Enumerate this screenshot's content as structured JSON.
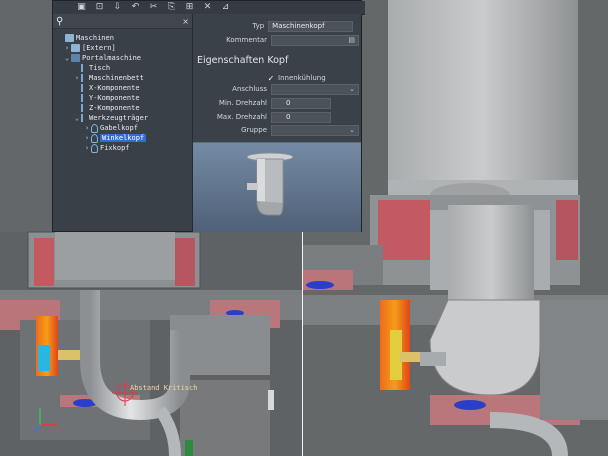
{
  "toolbar": {
    "icons": [
      "search-icon",
      "save-icon",
      "export-icon",
      "import-icon",
      "undo-icon",
      "cut-icon",
      "copy-icon",
      "paste-icon",
      "delete-icon",
      "machine-icon"
    ],
    "glyphs": [
      "",
      "▣",
      "⊡",
      "⇩",
      "↶",
      "✂",
      "⎘",
      "⊞",
      "✕",
      "⊿"
    ]
  },
  "tree": {
    "search_placeholder": "",
    "clear_glyph": "×",
    "nodes": [
      {
        "label": "Maschinen",
        "arrow": "",
        "icon": "folder"
      },
      {
        "label": "[Extern]",
        "arrow": "›",
        "icon": "folder"
      },
      {
        "label": "Portalmaschine",
        "arrow": "⌄",
        "icon": "part"
      },
      {
        "label": "Tisch",
        "arrow": "",
        "icon": "axis"
      },
      {
        "label": "Maschinenbett",
        "arrow": "›",
        "icon": "axis"
      },
      {
        "label": "X-Komponente",
        "arrow": "",
        "icon": "axis"
      },
      {
        "label": "Y-Komponente",
        "arrow": "",
        "icon": "axis"
      },
      {
        "label": "Z-Komponente",
        "arrow": "",
        "icon": "axis"
      },
      {
        "label": "Werkzeugträger",
        "arrow": "⌄",
        "icon": "axis"
      },
      {
        "label": "Gabelkopf",
        "arrow": "›",
        "icon": "tool"
      },
      {
        "label": "Winkelkopf",
        "arrow": "›",
        "icon": "tool"
      },
      {
        "label": "Fixkopf",
        "arrow": "›",
        "icon": "tool"
      }
    ]
  },
  "props": {
    "typ_label": "Typ",
    "typ_value": "Maschinenkopf",
    "kommentar_label": "Kommentar",
    "kommentar_value": "",
    "section_title": "Eigenschaften Kopf",
    "innenkuehlung_label": "Innenkühlung",
    "anschluss_label": "Anschluss",
    "anschluss_value": "",
    "min_label": "Min. Drehzahl",
    "min_value": "0",
    "max_label": "Max. Drehzahl",
    "max_value": "0",
    "gruppe_label": "Gruppe",
    "gruppe_value": ""
  },
  "viewport": {
    "annotation": "Abstand Kritisch",
    "axis_labels": [
      "X",
      "Y",
      "Z"
    ]
  },
  "colors": {
    "selection": "#2f6ecc",
    "panel": "#3b4148",
    "preview_top": "#748aa4"
  }
}
